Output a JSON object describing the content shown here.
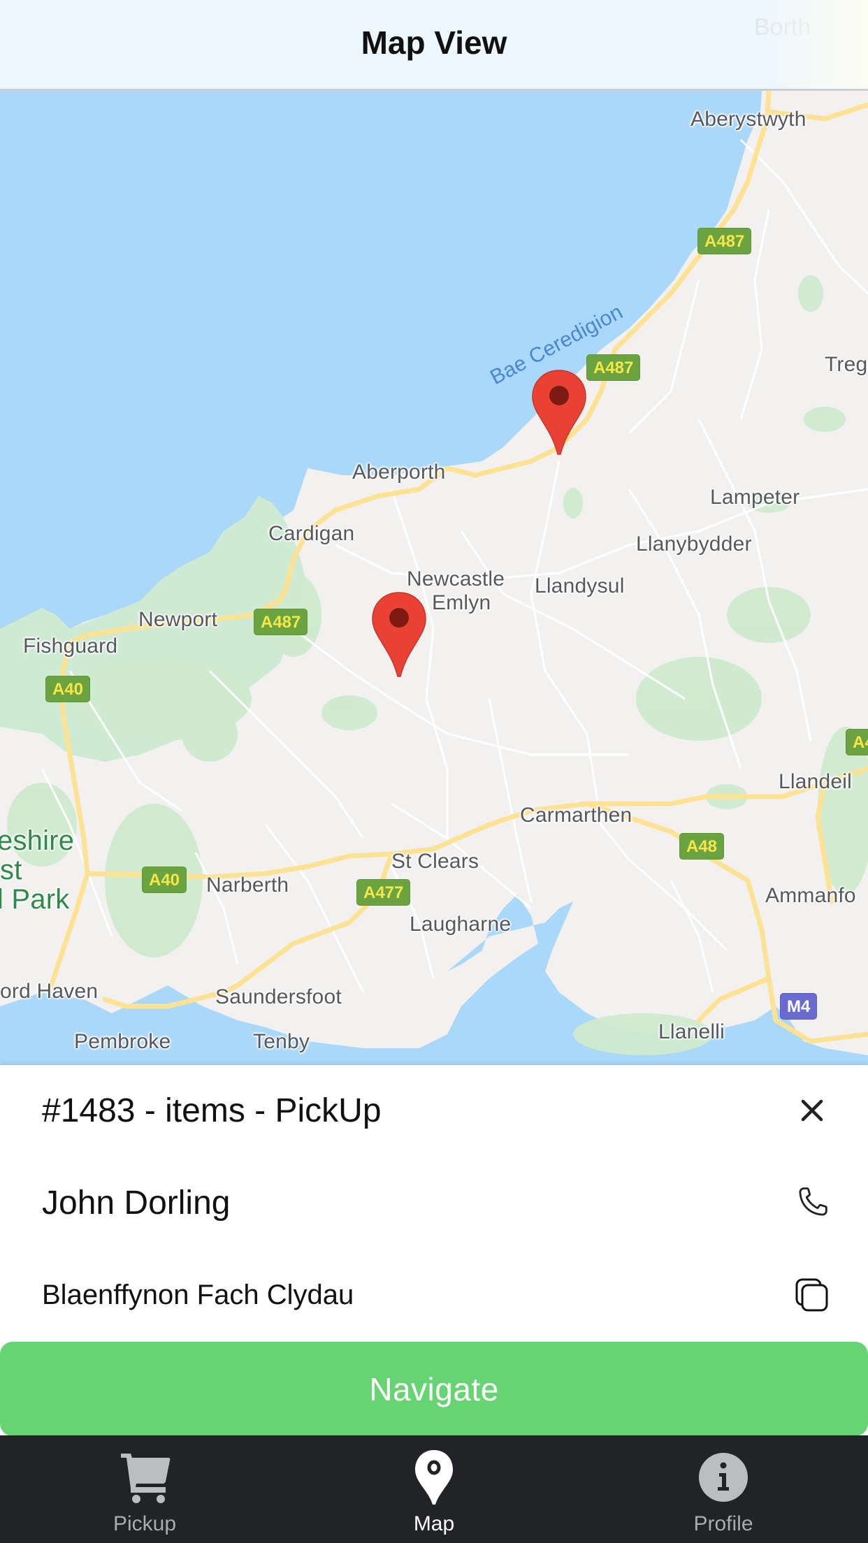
{
  "header": {
    "title": "Map View",
    "ghost_place": "Borth"
  },
  "map": {
    "places": {
      "aberystwyth": "Aberystwyth",
      "treg": "Treg",
      "bae_ceredigion": "Bae Ceredigion",
      "aberporth": "Aberporth",
      "lampeter": "Lampeter",
      "cardigan": "Cardigan",
      "llanybydder": "Llanybydder",
      "newcastle_emlyn_1": "Newcastle",
      "newcastle_emlyn_2": "Emlyn",
      "llandysul": "Llandysul",
      "newport": "Newport",
      "fishguard": "Fishguard",
      "llandeilo": "Llandeil",
      "carmarthen": "Carmarthen",
      "park_1": "eshire",
      "park_2": "st",
      "park_3": "l Park",
      "st_clears": "St Clears",
      "narberth": "Narberth",
      "ammanford": "Ammanfo",
      "laugharne": "Laugharne",
      "milford_haven": "ord Haven",
      "saundersfoot": "Saundersfoot",
      "pembroke": "Pembroke",
      "tenby": "Tenby",
      "llanelli": "Llanelli"
    },
    "road_shields": {
      "a487_north": "A487",
      "a487_mid": "A487",
      "a487_newport": "A487",
      "a40_fishguard": "A40",
      "a40_narberth": "A40",
      "a477": "A477",
      "a48": "A48",
      "a4_edge": "A4",
      "m4": "M4"
    },
    "markers": [
      {
        "name": "pickup-marker-north",
        "color": "#e94235"
      },
      {
        "name": "pickup-marker-south",
        "color": "#e94235"
      }
    ]
  },
  "pickup": {
    "order_line": "#1483 - items - PickUp",
    "customer_name": "John Dorling",
    "address": "Blaenffynon Fach Clydau",
    "close_icon": "close-icon",
    "phone_icon": "phone-icon",
    "copy_icon": "copy-icon"
  },
  "navigate": {
    "label": "Navigate",
    "color": "#67d473"
  },
  "tabbar": {
    "tabs": [
      {
        "label": "Pickup",
        "icon": "cart-icon",
        "active": false
      },
      {
        "label": "Map",
        "icon": "map-pin-icon",
        "active": true
      },
      {
        "label": "Profile",
        "icon": "info-icon",
        "active": false
      }
    ],
    "background": "#222327"
  }
}
